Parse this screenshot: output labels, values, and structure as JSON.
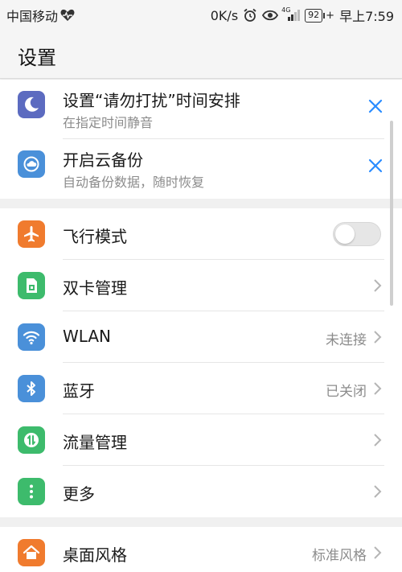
{
  "status_bar": {
    "carrier": "中国移动",
    "speed": "0K/s",
    "network_type": "4G",
    "battery": "92",
    "time": "早上7:59"
  },
  "header": {
    "title": "设置"
  },
  "suggestions": [
    {
      "title": "设置“请勿打扰”时间安排",
      "subtitle": "在指定时间静音",
      "icon": "moon-icon",
      "color": "#5c6bc0"
    },
    {
      "title": "开启云备份",
      "subtitle": "自动备份数据，随时恢复",
      "icon": "cloud-backup-icon",
      "color": "#4a90d9"
    }
  ],
  "network_items": [
    {
      "title": "飞行模式",
      "icon": "airplane-icon",
      "color": "#f07b2e",
      "toggle": false
    },
    {
      "title": "双卡管理",
      "icon": "sim-card-icon",
      "color": "#3dbb6c"
    },
    {
      "title": "WLAN",
      "value": "未连接",
      "icon": "wifi-icon",
      "color": "#4a90d9"
    },
    {
      "title": "蓝牙",
      "value": "已关闭",
      "icon": "bluetooth-icon",
      "color": "#4a90d9"
    },
    {
      "title": "流量管理",
      "icon": "data-usage-icon",
      "color": "#3dbb6c"
    },
    {
      "title": "更多",
      "icon": "more-icon",
      "color": "#3dbb6c"
    }
  ],
  "display_items": [
    {
      "title": "桌面风格",
      "value": "标准风格",
      "icon": "home-icon",
      "color": "#f07b2e"
    }
  ],
  "colors": {
    "accent": "#2a8cff",
    "background": "#f5f5f5",
    "divider": "#e6e6e6"
  }
}
